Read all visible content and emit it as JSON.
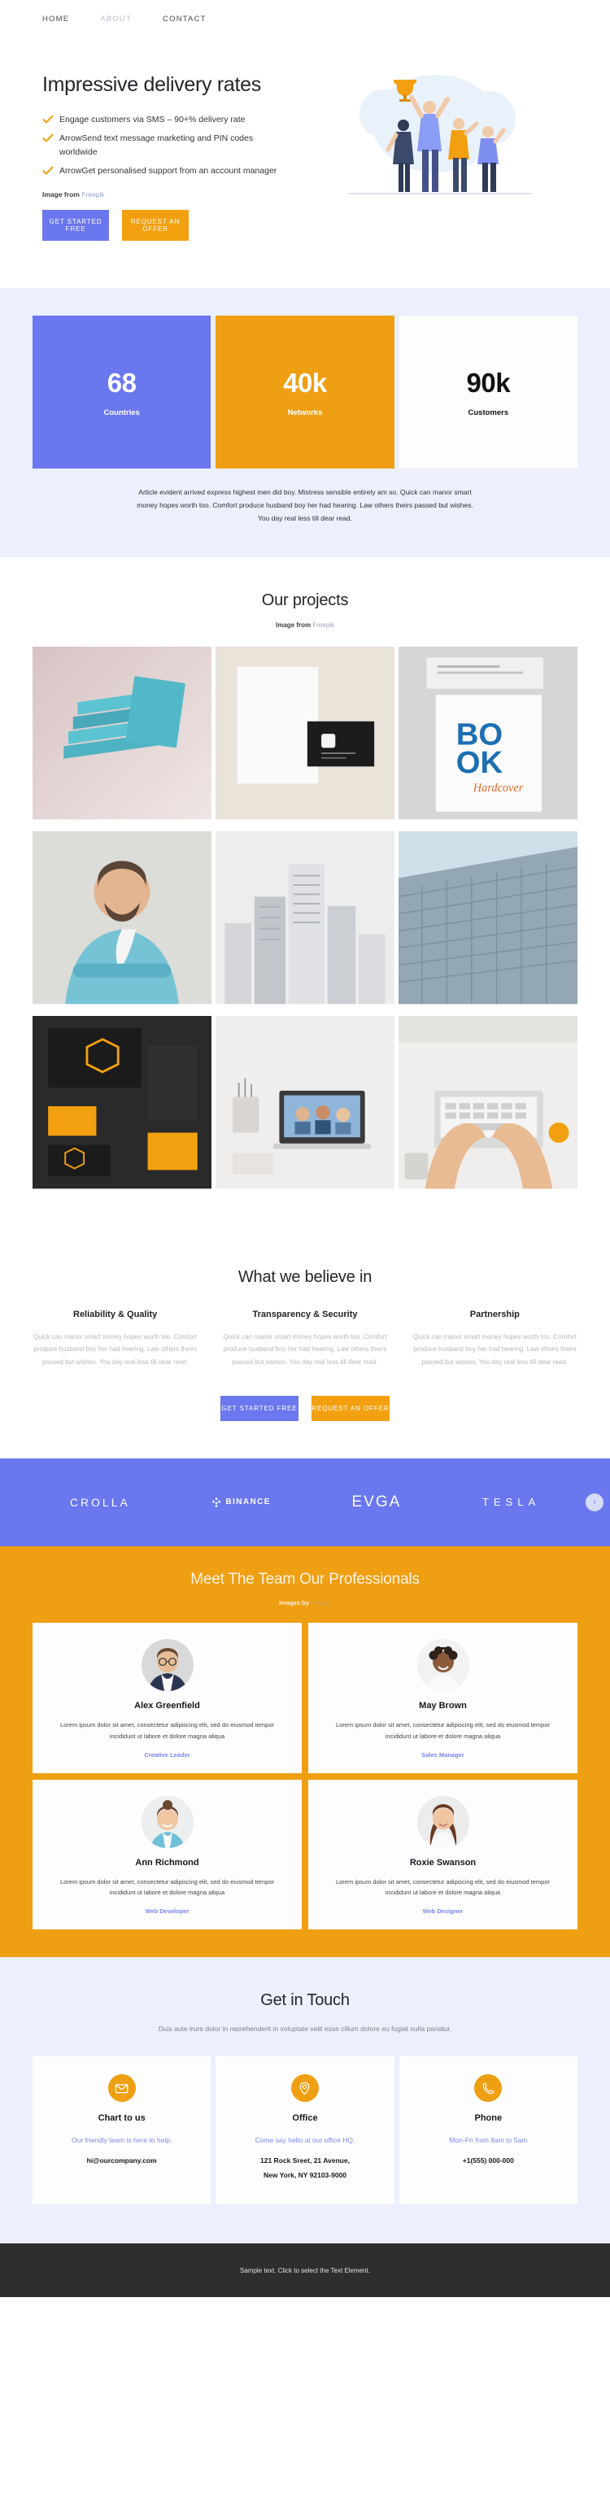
{
  "nav": {
    "items": [
      {
        "label": "HOME",
        "state": "active"
      },
      {
        "label": "ABOUT",
        "state": "muted"
      },
      {
        "label": "CONTACT",
        "state": "default"
      }
    ]
  },
  "hero": {
    "title": "Impressive delivery rates",
    "bullets": [
      "Engage customers via SMS – 90+% delivery rate",
      "ArrowSend text message marketing and PIN codes worldwide",
      "ArrowGet personalised support from an account manager"
    ],
    "credit_prefix": "Image from",
    "credit_link": "Freepik",
    "primary_button": "GET STARTED FREE",
    "secondary_button": "REQUEST AN OFFER",
    "illustration_name": "team-celebration-trophy-illustration"
  },
  "stats": {
    "items": [
      {
        "number": "68",
        "label": "Countries",
        "theme": "blue"
      },
      {
        "number": "40k",
        "label": "Networks",
        "theme": "orange"
      },
      {
        "number": "90k",
        "label": "Customers",
        "theme": "white"
      }
    ],
    "description": "Article evident arrived express highest men did boy. Mistress sensible entirely am so. Quick can manor smart money hopes worth too. Comfort produce husband boy her had hearing. Law others theirs passed but wishes. You day real less till dear read."
  },
  "projects": {
    "title": "Our projects",
    "credit_prefix": "Image from",
    "credit_link": "Freepik",
    "items": [
      {
        "name": "stacked-teal-books-mockup"
      },
      {
        "name": "black-white-business-card-mockup"
      },
      {
        "name": "book-hardcover-mockup"
      },
      {
        "name": "bearded-man-portrait-photo"
      },
      {
        "name": "city-skyscrapers-grayscale-photo"
      },
      {
        "name": "modern-glass-building-facade-photo"
      },
      {
        "name": "dark-orange-branding-stationery"
      },
      {
        "name": "desk-laptop-workspace-photo"
      },
      {
        "name": "hands-typing-laptop-desk-photo"
      }
    ]
  },
  "believe": {
    "title": "What we believe in",
    "columns": [
      {
        "heading": "Reliability & Quality",
        "text": "Quick can manor smart money hopes worth too. Comfort produce husband boy her had hearing. Law others theirs passed but wishes. You day real less till dear read."
      },
      {
        "heading": "Transparency & Security",
        "text": "Quick can manor smart money hopes worth too. Comfort produce husband boy her had hearing. Law others theirs passed but wishes. You day real less till dear read."
      },
      {
        "heading": "Partnership",
        "text": "Quick can manor smart money hopes worth too. Comfort produce husband boy her had hearing. Law others theirs passed but wishes. You day real less till dear read."
      }
    ],
    "primary_button": "GET STARTED FREE",
    "secondary_button": "REQUEST AN OFFER"
  },
  "logos": {
    "items": [
      {
        "label": "CROLLA",
        "style": "plain"
      },
      {
        "label": "BINANCE",
        "style": "binance"
      },
      {
        "label": "EVGA",
        "style": "evga"
      },
      {
        "label": "TESLA",
        "style": "tesla"
      }
    ],
    "next_arrow": "›"
  },
  "team": {
    "title": "Meet The Team Our Professionals",
    "credit_prefix": "Images by",
    "credit_link": "Freepik",
    "members": [
      {
        "name": "Alex Greenfield",
        "description": "Lorem ipsum dolor sit amet, consectetur adipiscing elit, sed do eiusmod tempor incididunt ut labore et dolore magna aliqua",
        "role": "Creative Leader",
        "avatar_name": "avatar-man-glasses-suit"
      },
      {
        "name": "May Brown",
        "description": "Lorem ipsum dolor sit amet, consectetur adipiscing elit, sed do eiusmod tempor incididunt ut labore et dolore magna aliqua",
        "role": "Sales Manager",
        "avatar_name": "avatar-woman-curly-hair"
      },
      {
        "name": "Ann Richmond",
        "description": "Lorem ipsum dolor sit amet, consectetur adipiscing elit, sed do eiusmod tempor incididunt ut labore et dolore magna aliqua",
        "role": "Web Developer",
        "avatar_name": "avatar-woman-bun-blue-shirt"
      },
      {
        "name": "Roxie Swanson",
        "description": "Lorem ipsum dolor sit amet, consectetur adipiscing elit, sed do eiusmod tempor incididunt ut labore et dolore magna aliqua",
        "role": "Web Designer",
        "avatar_name": "avatar-woman-long-brown-hair"
      }
    ]
  },
  "contact": {
    "title": "Get in Touch",
    "subtitle": "Duis aute irure dolor in reprehenderit in voluptate velit esse cillum dolore eu fugiat nulla pariatur.",
    "cards": [
      {
        "icon": "envelope-icon",
        "title": "Chart to us",
        "note": "Our friendly team is here to help.",
        "value_line1": "hi@ourcompany.com",
        "value_line2": ""
      },
      {
        "icon": "location-pin-icon",
        "title": "Office",
        "note": "Come say hello at our office HQ.",
        "value_line1": "121 Rock Sreet, 21 Avenue,",
        "value_line2": "New York, NY 92103-9000"
      },
      {
        "icon": "phone-icon",
        "title": "Phone",
        "note": "Mon-Fri from 8am to 5am",
        "value_line1": "+1(555) 000-000",
        "value_line2": ""
      }
    ]
  },
  "footer": {
    "text": "Sample text. Click to select the Text Element."
  },
  "colors": {
    "blue": "#6b77ee",
    "orange": "#ef9f12",
    "lavender_bg": "#eceffd",
    "footer_bg": "#2e2e2e",
    "link_lavender": "#9aa4c9"
  }
}
